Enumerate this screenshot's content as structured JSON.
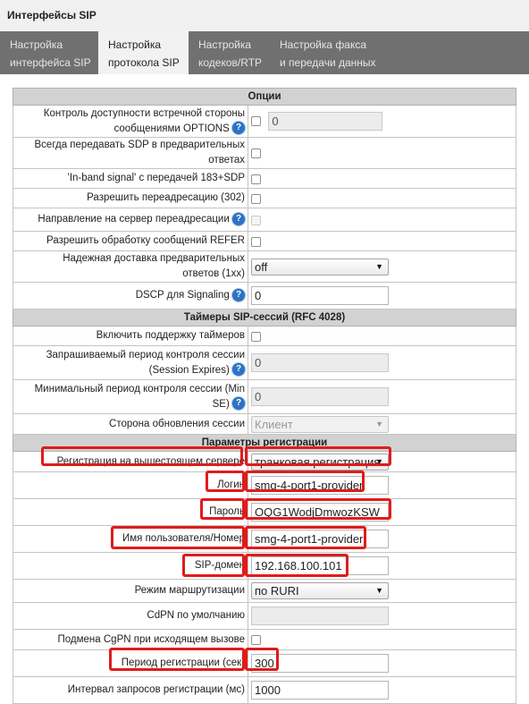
{
  "window": {
    "title": "Интерфейсы SIP"
  },
  "tabs": [
    {
      "line1": "Настройка",
      "line2": "интерфейса SIP",
      "active": false
    },
    {
      "line1": "Настройка",
      "line2": "протокола SIP",
      "active": true
    },
    {
      "line1": "Настройка",
      "line2": "кодеков/RTP",
      "active": false
    },
    {
      "line1": "Настройка факса",
      "line2": "и передачи данных",
      "active": false
    }
  ],
  "sections": {
    "options": "Опции",
    "timers": "Таймеры SIP-сессий (RFC 4028)",
    "registration": "Параметры регистрации"
  },
  "options": {
    "options_check": {
      "label_l1": "Контроль доступности встречной стороны",
      "label_l2": "сообщениями OPTIONS",
      "value": "0"
    },
    "sdp_preliminary": {
      "label_l1": "Всегда передавать SDP в предварительных",
      "label_l2": "ответах"
    },
    "inband": {
      "label": "'In-band signal' с передачей 183+SDP"
    },
    "redirect_302": {
      "label": "Разрешить переадресацию (302)"
    },
    "redirect_direction": {
      "label": "Направление на сервер переадресации"
    },
    "refer": {
      "label": "Разрешить обработку сообщений REFER"
    },
    "reliable": {
      "label_l1": "Надежная доставка предварительных",
      "label_l2": "ответов (1xx)",
      "value": "off"
    },
    "dscp": {
      "label": "DSCP для Signaling",
      "value": "0"
    }
  },
  "timers": {
    "enable": {
      "label": "Включить поддержку таймеров"
    },
    "session_expires": {
      "label_l1": "Запрашиваемый период контроля сессии",
      "label_l2": "(Session Expires)",
      "value": "0"
    },
    "min_se": {
      "label_l1": "Минимальный период контроля сессии (Min",
      "label_l2": "SE)",
      "value": "0"
    },
    "refresher": {
      "label": "Сторона обновления сессии",
      "value": "Клиент"
    }
  },
  "registration": {
    "upstream": {
      "label": "Регистрация на вышестоящем сервере",
      "value": "транковая регистрация"
    },
    "login": {
      "label": "Логин",
      "value": "smg-4-port1-provider"
    },
    "password": {
      "label": "Пароль",
      "value": "OQG1WodjDmwozKSW"
    },
    "username": {
      "label": "Имя пользователя/Номер",
      "value": "smg-4-port1-provider"
    },
    "domain": {
      "label": "SIP-домен",
      "value": "192.168.100.101"
    },
    "routing": {
      "label": "Режим маршрутизации",
      "value": "по RURI"
    },
    "cdpn": {
      "label": "CdPN по умолчанию",
      "value": ""
    },
    "cgpn": {
      "label": "Подмена CgPN при исходящем вызове"
    },
    "period": {
      "label": "Период регистрации (сек)",
      "value": "300"
    },
    "interval": {
      "label": "Интервал запросов регистрации (мс)",
      "value": "1000"
    }
  },
  "icons": {
    "help": "question-mark-circle-icon",
    "dropdown": "triangle-down-icon"
  },
  "colors": {
    "tab_bar": "#707070",
    "section_header": "#d2d2d2",
    "highlight": "#e01b1b",
    "help_icon": "#2d72c4"
  }
}
